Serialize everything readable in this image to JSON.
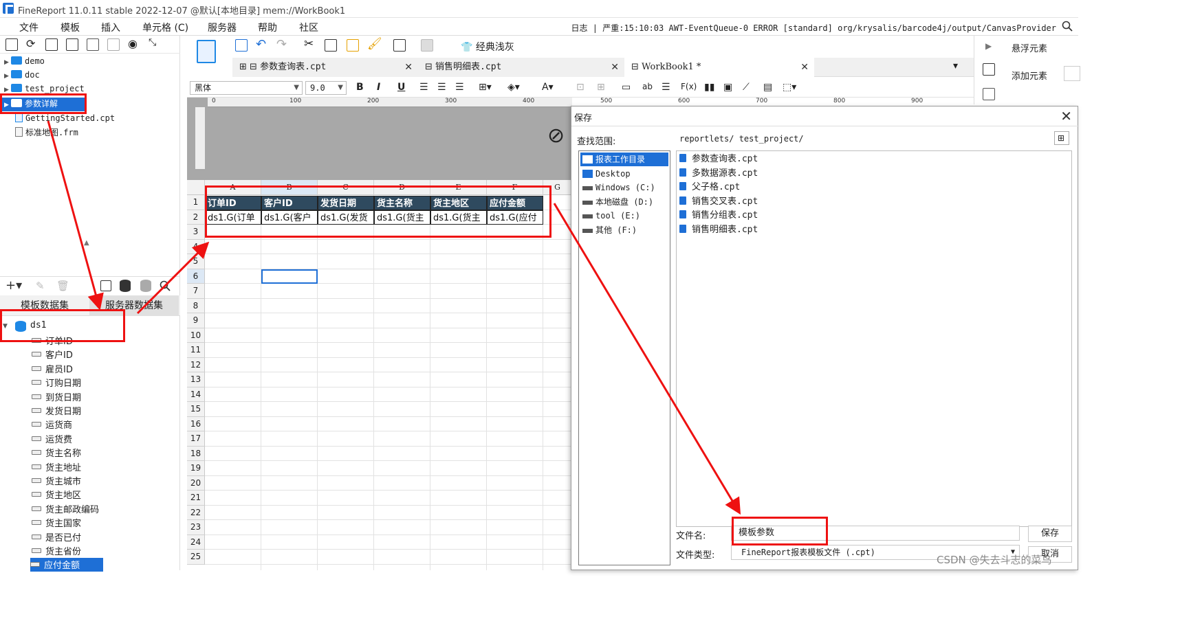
{
  "titlebar": {
    "title": "FineReport 11.0.11 stable 2022-12-07 @默认[本地目录]     mem://WorkBook1"
  },
  "menu": {
    "items": [
      "文件",
      "模板",
      "插入",
      "单元格 (C)",
      "服务器",
      "帮助",
      "社区"
    ],
    "log": "日志 | 严重:15:10:03 AWT-EventQueue-0 ERROR [standard] org/krysalis/barcode4j/output/CanvasProvider"
  },
  "tree": {
    "items": [
      {
        "label": "demo",
        "type": "folder"
      },
      {
        "label": "doc",
        "type": "folder"
      },
      {
        "label": "test_project",
        "type": "folder"
      },
      {
        "label": "参数详解",
        "type": "folder",
        "selected": true
      },
      {
        "label": "GettingStarted.cpt",
        "type": "file"
      },
      {
        "label": "标准地图.frm",
        "type": "file"
      }
    ]
  },
  "datasets": {
    "tabs": [
      "模板数据集",
      "服务器数据集"
    ],
    "root": "ds1",
    "fields": [
      "订单ID",
      "客户ID",
      "雇员ID",
      "订购日期",
      "到货日期",
      "发货日期",
      "运货商",
      "运货费",
      "货主名称",
      "货主地址",
      "货主城市",
      "货主地区",
      "货主邮政编码",
      "货主国家",
      "是否已付",
      "货主省份",
      "应付金额"
    ]
  },
  "right_panel": {
    "float_label": "悬浮元素",
    "add_label": "添加元素"
  },
  "toolbar": {
    "theme_label": "经典浅灰",
    "font_name": "黑体",
    "font_size": "9.0"
  },
  "doc_tabs": [
    {
      "label": "参数查询表.cpt"
    },
    {
      "label": "销售明细表.cpt"
    },
    {
      "label": "WorkBook1 *"
    }
  ],
  "ruler": {
    "ticks": [
      "0",
      "100",
      "200",
      "300",
      "400",
      "500",
      "600",
      "700",
      "800",
      "900"
    ]
  },
  "grid": {
    "columns": [
      "A",
      "B",
      "C",
      "D",
      "E",
      "F",
      "G"
    ],
    "rows": [
      "1",
      "2",
      "3",
      "4",
      "5",
      "6",
      "7",
      "8",
      "9",
      "10",
      "11",
      "12",
      "13",
      "14",
      "15",
      "16",
      "17",
      "18",
      "19",
      "20",
      "21",
      "22",
      "23",
      "24",
      "25"
    ],
    "header_cells": [
      "订单ID",
      "客户ID",
      "发货日期",
      "货主名称",
      "货主地区",
      "应付金额"
    ],
    "data_cells": [
      "ds1.G(订单",
      "ds1.G(客户",
      "ds1.G(发货",
      "ds1.G(货主",
      "ds1.G(货主",
      "ds1.G(应付"
    ]
  },
  "dialog": {
    "title": "保存",
    "scope_label": "查找范围:",
    "path": "reportlets/ test_project/",
    "places": [
      {
        "label": "报表工作目录",
        "selected": true
      },
      {
        "label": "Desktop"
      },
      {
        "label": "Windows (C:)"
      },
      {
        "label": "本地磁盘 (D:)"
      },
      {
        "label": "tool (E:)"
      },
      {
        "label": "其他 (F:)"
      }
    ],
    "files": [
      "参数查询表.cpt",
      "多数据源表.cpt",
      "父子格.cpt",
      "销售交叉表.cpt",
      "销售分组表.cpt",
      "销售明细表.cpt"
    ],
    "filename_label": "文件名:",
    "filename_value": "模板参数",
    "filetype_label": "文件类型:",
    "filetype_value": "FineReport报表模板文件 (.cpt)",
    "save_label": "保存",
    "cancel_label": "取消"
  },
  "watermark": "CSDN @失去斗志的菜鸟",
  "colors": {
    "header_fill": "#2f4a5f",
    "selection": "#1e6fd6",
    "annotation": "#ee1111"
  }
}
